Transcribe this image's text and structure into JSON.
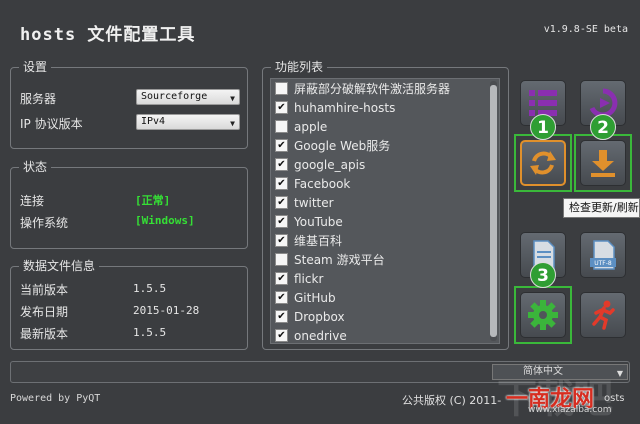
{
  "app": {
    "title": "hosts 文件配置工具",
    "version": "v1.9.8-SE beta"
  },
  "settings": {
    "label": "设置",
    "server_label": "服务器",
    "server_value": "Sourceforge",
    "ip_label": "IP 协议版本",
    "ip_value": "IPv4"
  },
  "status": {
    "label": "状态",
    "connection_label": "连接",
    "connection_value": "[正常]",
    "os_label": "操作系统",
    "os_value": "[Windows]"
  },
  "datafile": {
    "label": "数据文件信息",
    "current_label": "当前版本",
    "current_value": "1.5.5",
    "release_label": "发布日期",
    "release_value": "2015-01-28",
    "latest_label": "最新版本",
    "latest_value": "1.5.5"
  },
  "functions": {
    "label": "功能列表",
    "items": [
      {
        "label": "屏蔽部分破解软件激活服务器",
        "checked": false
      },
      {
        "label": "huhamhire-hosts",
        "checked": true
      },
      {
        "label": "apple",
        "checked": false
      },
      {
        "label": "Google Web服务",
        "checked": true
      },
      {
        "label": "google_apis",
        "checked": true
      },
      {
        "label": "Facebook",
        "checked": true
      },
      {
        "label": "twitter",
        "checked": true
      },
      {
        "label": "YouTube",
        "checked": true
      },
      {
        "label": "维基百科",
        "checked": true
      },
      {
        "label": "Steam 游戏平台",
        "checked": false
      },
      {
        "label": "flickr",
        "checked": true
      },
      {
        "label": "GitHub",
        "checked": true
      },
      {
        "label": "Dropbox",
        "checked": true
      },
      {
        "label": "onedrive",
        "checked": true
      }
    ]
  },
  "toolbar": {
    "badge_1": "1",
    "badge_2": "2",
    "badge_3": "3",
    "utf8_label": "UTF-8",
    "tooltip": "检查更新/刷新"
  },
  "footer": {
    "language": "简体中文",
    "powered_by": "Powered by PyQT",
    "copyright": "公共版权 (C) 2011-",
    "watermark_main": "一南龙网",
    "watermark_url": "www.xiazaiba.com",
    "watermark_bg": "下载吧",
    "copyright_tail": "osts"
  },
  "colors": {
    "background": "#3b3d40",
    "status_ok": "#35e035",
    "highlight": "#3ab83a",
    "badge": "#2f9e33"
  }
}
